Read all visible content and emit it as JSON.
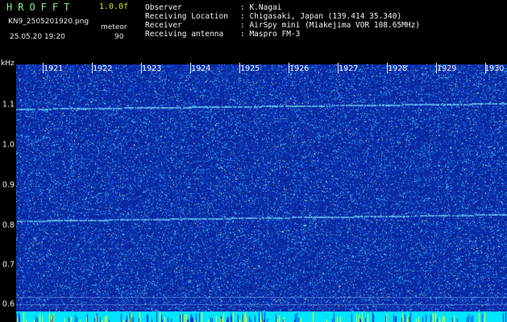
{
  "header": {
    "app_title": "HROFFT",
    "version": "1.0.0f",
    "filename": "KN9_2505201920.png",
    "mode": "meteor",
    "datetime": "25.05.20 19:20",
    "count": "90"
  },
  "info": [
    {
      "label": "Observer",
      "value": ": K.Nagai"
    },
    {
      "label": "Receiving Location",
      "value": ": Chigasaki, Japan (139.414 35.340)"
    },
    {
      "label": "Receiver",
      "value": ": AirSpy mini (Miakejima VOR 108.65MHz)"
    },
    {
      "label": "Receiving antenna",
      "value": ": Maspro FM-3"
    }
  ],
  "axis": {
    "y_unit": "kHz",
    "y_ticks": [
      "1.1",
      "1.0",
      "0.9",
      "0.8",
      "0.7",
      "0.6"
    ],
    "time_ticks": [
      "1921",
      "1922",
      "1923",
      "1924",
      "1925",
      "1926",
      "1927",
      "1928",
      "1929",
      "1930"
    ]
  },
  "colors": {
    "background": "#000000",
    "spectrum_base": "#0a1d9a",
    "noise_light": "#2c6cf0",
    "carrier": "#7ad9ff",
    "baseline_cyan": "#00e5ff",
    "baseline_yellow": "#ffff00"
  }
}
